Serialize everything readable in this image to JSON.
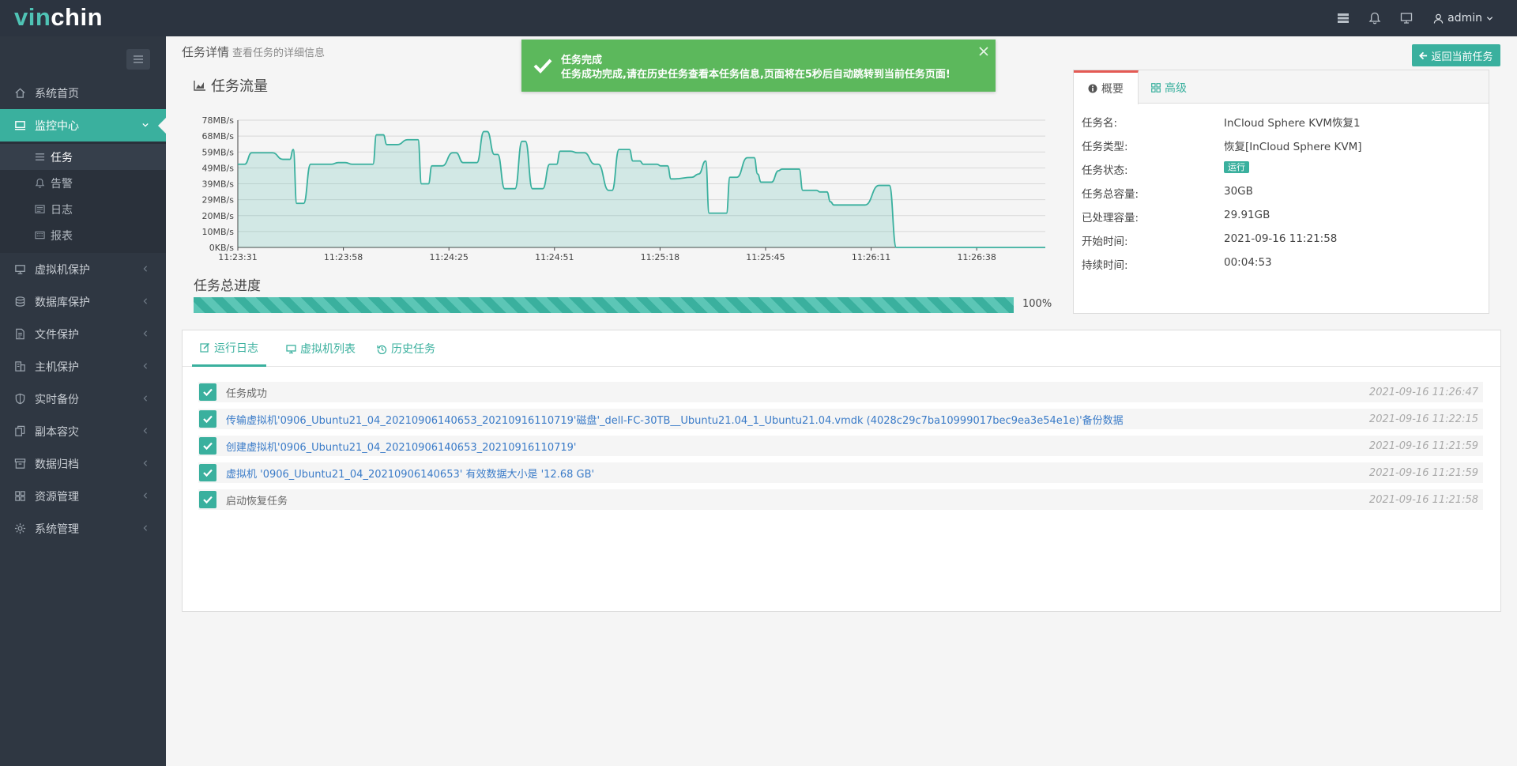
{
  "brand": {
    "logo_prefix": "vin",
    "logo_suffix": "chin"
  },
  "topbar": {
    "user": "admin"
  },
  "sidebar": {
    "items": [
      {
        "label": "系统首页",
        "icon": "home-icon"
      },
      {
        "label": "监控中心",
        "icon": "monitor-icon",
        "active": true
      },
      {
        "label": "虚拟机保护",
        "icon": "desktop-icon"
      },
      {
        "label": "数据库保护",
        "icon": "database-icon"
      },
      {
        "label": "文件保护",
        "icon": "file-icon"
      },
      {
        "label": "主机保护",
        "icon": "server-icon"
      },
      {
        "label": "实时备份",
        "icon": "shield-icon"
      },
      {
        "label": "副本容灾",
        "icon": "copy-icon"
      },
      {
        "label": "数据归档",
        "icon": "archive-icon"
      },
      {
        "label": "资源管理",
        "icon": "grid-icon"
      },
      {
        "label": "系统管理",
        "icon": "gear-icon"
      }
    ],
    "sub_items": [
      {
        "label": "任务",
        "icon": "list-icon"
      },
      {
        "label": "告警",
        "icon": "bell-icon"
      },
      {
        "label": "日志",
        "icon": "log-icon"
      },
      {
        "label": "报表",
        "icon": "report-icon"
      }
    ]
  },
  "header": {
    "title": "任务详情",
    "subtitle": "查看任务的详细信息",
    "back_button": "返回当前任务"
  },
  "toast": {
    "title": "任务完成",
    "message": "任务成功完成,请在历史任务查看本任务信息,页面将在5秒后自动跳转到当前任务页面!"
  },
  "flow_section": {
    "title": "任务流量"
  },
  "chart_data": {
    "type": "area",
    "x_ticks": [
      "11:23:31",
      "11:23:58",
      "11:24:25",
      "11:24:51",
      "11:25:18",
      "11:25:45",
      "11:26:11",
      "11:26:38"
    ],
    "y_ticks": [
      "0KB/s",
      "10MB/s",
      "20MB/s",
      "29MB/s",
      "39MB/s",
      "49MB/s",
      "59MB/s",
      "68MB/s",
      "78MB/s"
    ],
    "ylim": [
      0,
      78
    ],
    "ylabel": "",
    "xlabel": "",
    "title": "",
    "color": "#3ab09e",
    "x_seconds": [
      0,
      2,
      4,
      10,
      13,
      15,
      16,
      17,
      19,
      21,
      27,
      29,
      31,
      33,
      39,
      40,
      42,
      43,
      46,
      49,
      52,
      53,
      55,
      56,
      59,
      62,
      63,
      65,
      69,
      71,
      72,
      74,
      75,
      77,
      80,
      82,
      83,
      85,
      88,
      90,
      92,
      93,
      96,
      98,
      100,
      103,
      104,
      107,
      108,
      110,
      113,
      114,
      116,
      117,
      121,
      122,
      124,
      125,
      126,
      131,
      133,
      135,
      136,
      141,
      142,
      144,
      147,
      149,
      150,
      151,
      154,
      156,
      157,
      162,
      163,
      167,
      168,
      170,
      171,
      172,
      180,
      181,
      185,
      188,
      190,
      193,
      195,
      196,
      198,
      199,
      200,
      202,
      203,
      205,
      211,
      212,
      215,
      217,
      218,
      222,
      223,
      225,
      226,
      229,
      230,
      232,
      233
    ],
    "values": [
      51,
      51,
      58,
      58,
      54,
      54,
      60,
      27,
      27,
      51,
      51,
      52,
      52,
      51,
      51,
      69,
      69,
      63,
      63,
      66,
      66,
      39,
      39,
      50,
      50,
      58,
      58,
      52,
      52,
      71,
      71,
      57,
      57,
      36,
      36,
      65,
      65,
      36,
      36,
      51,
      51,
      59,
      59,
      58,
      58,
      51,
      51,
      35,
      35,
      60,
      60,
      53,
      53,
      51,
      51,
      50,
      50,
      42,
      42,
      43,
      45,
      53,
      21,
      21,
      43,
      43,
      55,
      55,
      45,
      40,
      40,
      47,
      48,
      48,
      35,
      35,
      34,
      34,
      28,
      26,
      26,
      26,
      38,
      38,
      0,
      0,
      0,
      0,
      0,
      0,
      0,
      0,
      0,
      0,
      0,
      0,
      0,
      0,
      0,
      0,
      0,
      0,
      0,
      0,
      0,
      0,
      0
    ]
  },
  "progress": {
    "title": "任务总进度",
    "value": 100,
    "label": "100%"
  },
  "detail_panel": {
    "tabs": [
      {
        "label": "概要",
        "icon": "info-icon"
      },
      {
        "label": "高级",
        "icon": "grid-icon"
      }
    ],
    "rows": [
      {
        "label": "任务名:",
        "value": "InCloud Sphere KVM恢复1"
      },
      {
        "label": "任务类型:",
        "value": "恢复[InCloud Sphere KVM]"
      },
      {
        "label": "任务状态:",
        "value": "运行"
      },
      {
        "label": "任务总容量:",
        "value": "30GB"
      },
      {
        "label": "已处理容量:",
        "value": "29.91GB"
      },
      {
        "label": "开始时间:",
        "value": "2021-09-16 11:21:58"
      },
      {
        "label": "持续时间:",
        "value": "00:04:53"
      }
    ]
  },
  "log_panel": {
    "tabs": [
      {
        "label": "运行日志",
        "icon": "edit-icon"
      },
      {
        "label": "虚拟机列表",
        "icon": "desktop-icon"
      },
      {
        "label": "历史任务",
        "icon": "history-icon"
      }
    ],
    "entries": [
      {
        "text": "任务成功",
        "time": "2021-09-16 11:26:47",
        "link": false
      },
      {
        "text": "传输虚拟机'0906_Ubuntu21_04_20210906140653_20210916110719'磁盘'_dell-FC-30TB__Ubuntu21.04_1_Ubuntu21.04.vmdk (4028c29c7ba10999017bec9ea3e54e1e)'备份数据",
        "time": "2021-09-16 11:22:15",
        "link": true
      },
      {
        "text": "创建虚拟机'0906_Ubuntu21_04_20210906140653_20210916110719'",
        "time": "2021-09-16 11:21:59",
        "link": true
      },
      {
        "text": "虚拟机 '0906_Ubuntu21_04_20210906140653' 有效数据大小是 '12.68 GB'",
        "time": "2021-09-16 11:21:59",
        "link": true
      },
      {
        "text": "启动恢复任务",
        "time": "2021-09-16 11:21:58",
        "link": false
      }
    ]
  }
}
